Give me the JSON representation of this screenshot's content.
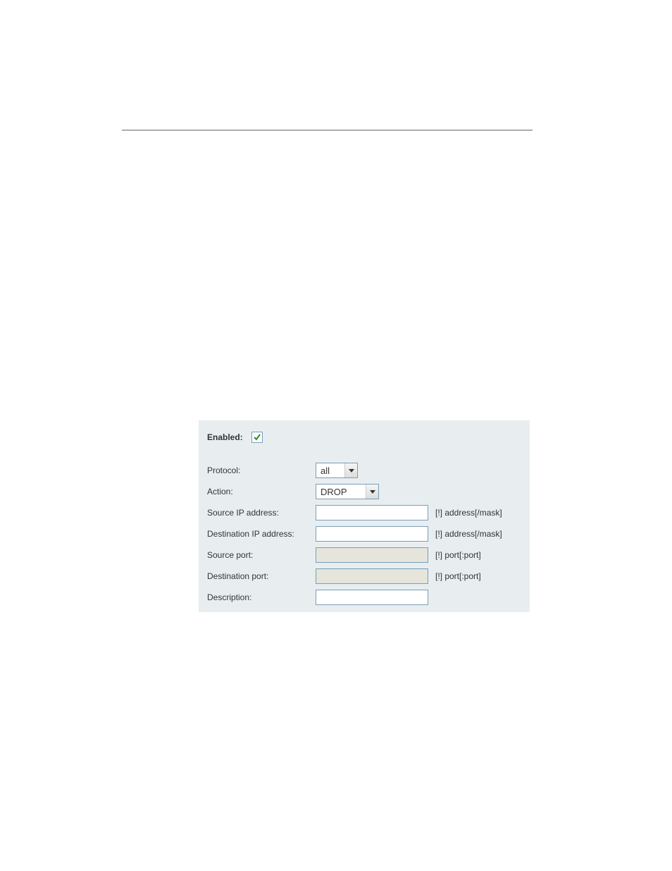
{
  "form": {
    "enabled_label": "Enabled:",
    "enabled_checked": true,
    "rows": {
      "protocol": {
        "label": "Protocol:",
        "value": "all"
      },
      "action": {
        "label": "Action:",
        "value": "DROP"
      },
      "source_ip": {
        "label": "Source IP address:",
        "value": "",
        "hint": "[!] address[/mask]"
      },
      "dest_ip": {
        "label": "Destination IP address:",
        "value": "",
        "hint": "[!] address[/mask]"
      },
      "source_port": {
        "label": "Source port:",
        "value": "",
        "hint": "[!] port[:port]"
      },
      "dest_port": {
        "label": "Destination port:",
        "value": "",
        "hint": "[!] port[:port]"
      },
      "description": {
        "label": "Description:",
        "value": ""
      }
    }
  }
}
